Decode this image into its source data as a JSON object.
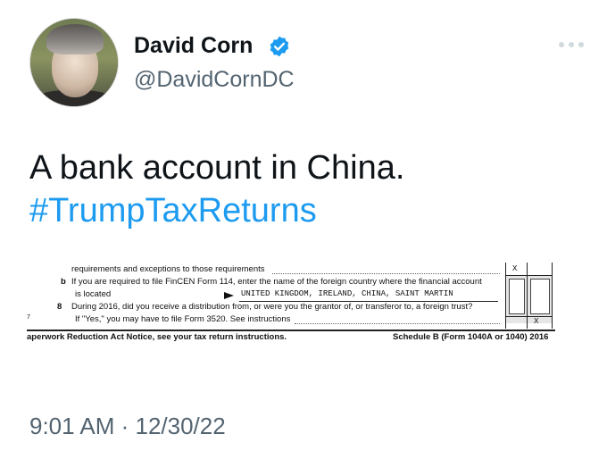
{
  "tweet": {
    "author_name": "David Corn",
    "author_handle": "@DavidCornDC",
    "verified": true,
    "text_line1": "A bank account in China.",
    "hashtag": "#TrumpTaxReturns",
    "timestamp": "9:01 AM · 12/30/22"
  },
  "form_image": {
    "line1": "requirements and exceptions to those requirements",
    "line2_label": "b",
    "line2": "If you are required to file FinCEN Form 114, enter the name of the foreign country where the financial account",
    "line3": "is located",
    "countries": "UNITED KINGDOM, IRELAND, CHINA, SAINT MARTIN",
    "line4_num": "8",
    "line4": "During 2016, did you receive a distribution from, or were you the grantor of, or transferor to, a foreign trust?",
    "line5_num": "7",
    "line5": "If \"Yes,\" you may have to file Form 3520. See instructions",
    "mark1": "X",
    "mark2": "X",
    "footer_left": "aperwork Reduction Act Notice, see your tax return instructions.",
    "footer_right": "Schedule B (Form 1040A or 1040) 2016"
  },
  "colors": {
    "link": "#1d9bf0",
    "verified_badge": "#1d9bf0",
    "secondary_text": "#536471",
    "primary_text": "#0f1419"
  },
  "icons": {
    "verified": "verified-badge-icon",
    "more": "more-options-icon",
    "arrow": "right-arrow-icon"
  }
}
